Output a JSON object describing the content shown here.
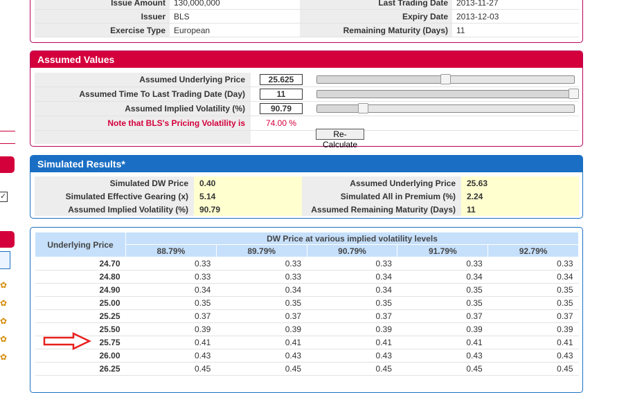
{
  "info": {
    "rows": [
      {
        "l1": "Issue Amount",
        "v1": "130,000,000",
        "l2": "Last Trading Date",
        "v2": "2013-11-27"
      },
      {
        "l1": "Issuer",
        "v1": "BLS",
        "l2": "Expiry Date",
        "v2": "2013-12-03"
      },
      {
        "l1": "Exercise Type",
        "v1": "European",
        "l2": "Remaining Maturity (Days)",
        "v2": "11"
      }
    ]
  },
  "assumed": {
    "title": "Assumed Values",
    "underlying_label": "Assumed Underlying Price",
    "underlying_value": "25.625",
    "underlying_slider": 0.5,
    "time_label": "Assumed Time To Last Trading Date (Day)",
    "time_value": "11",
    "time_slider": 1.0,
    "vol_label": "Assumed Implied Volatility (%)",
    "vol_value": "90.79",
    "vol_slider": 0.18,
    "note_label": "Note that BLS's Pricing Volatility is",
    "note_value": "74.00 %",
    "recalc_label": "Re-Calculate"
  },
  "simulated": {
    "title": "Simulated Results*",
    "rows": [
      {
        "l1": "Simulated DW Price",
        "v1": "0.40",
        "l2": "Assumed Underlying Price",
        "v2": "25.63"
      },
      {
        "l1": "Simulated Effective Gearing (x)",
        "v1": "5.14",
        "l2": "Simulated All in Premium (%)",
        "v2": "2.24"
      },
      {
        "l1": "Assumed Implied Volatility (%)",
        "v1": "90.79",
        "l2": "Assumed Remaining Maturity (Days)",
        "v2": "11"
      }
    ]
  },
  "price_table": {
    "row_header": "Underlying Price",
    "group_header": "DW Price at various implied volatility levels",
    "columns": [
      "88.79%",
      "89.79%",
      "90.79%",
      "91.79%",
      "92.79%"
    ],
    "rows": [
      {
        "price": "24.70",
        "vals": [
          "0.33",
          "0.33",
          "0.33",
          "0.33",
          "0.33"
        ]
      },
      {
        "price": "24.80",
        "vals": [
          "0.33",
          "0.33",
          "0.34",
          "0.34",
          "0.34"
        ]
      },
      {
        "price": "24.90",
        "vals": [
          "0.34",
          "0.34",
          "0.34",
          "0.35",
          "0.35"
        ]
      },
      {
        "price": "25.00",
        "vals": [
          "0.35",
          "0.35",
          "0.35",
          "0.35",
          "0.35"
        ]
      },
      {
        "price": "25.25",
        "vals": [
          "0.37",
          "0.37",
          "0.37",
          "0.37",
          "0.37"
        ]
      },
      {
        "price": "25.50",
        "vals": [
          "0.39",
          "0.39",
          "0.39",
          "0.39",
          "0.39"
        ]
      },
      {
        "price": "25.75",
        "vals": [
          "0.41",
          "0.41",
          "0.41",
          "0.41",
          "0.41"
        ]
      },
      {
        "price": "26.00",
        "vals": [
          "0.43",
          "0.43",
          "0.43",
          "0.43",
          "0.43"
        ]
      },
      {
        "price": "26.25",
        "vals": [
          "0.45",
          "0.45",
          "0.45",
          "0.45",
          "0.45"
        ]
      }
    ]
  },
  "colors": {
    "red_header": "#d4003c",
    "blue_header": "#1a6fc4",
    "arrow": "#e8201c"
  }
}
